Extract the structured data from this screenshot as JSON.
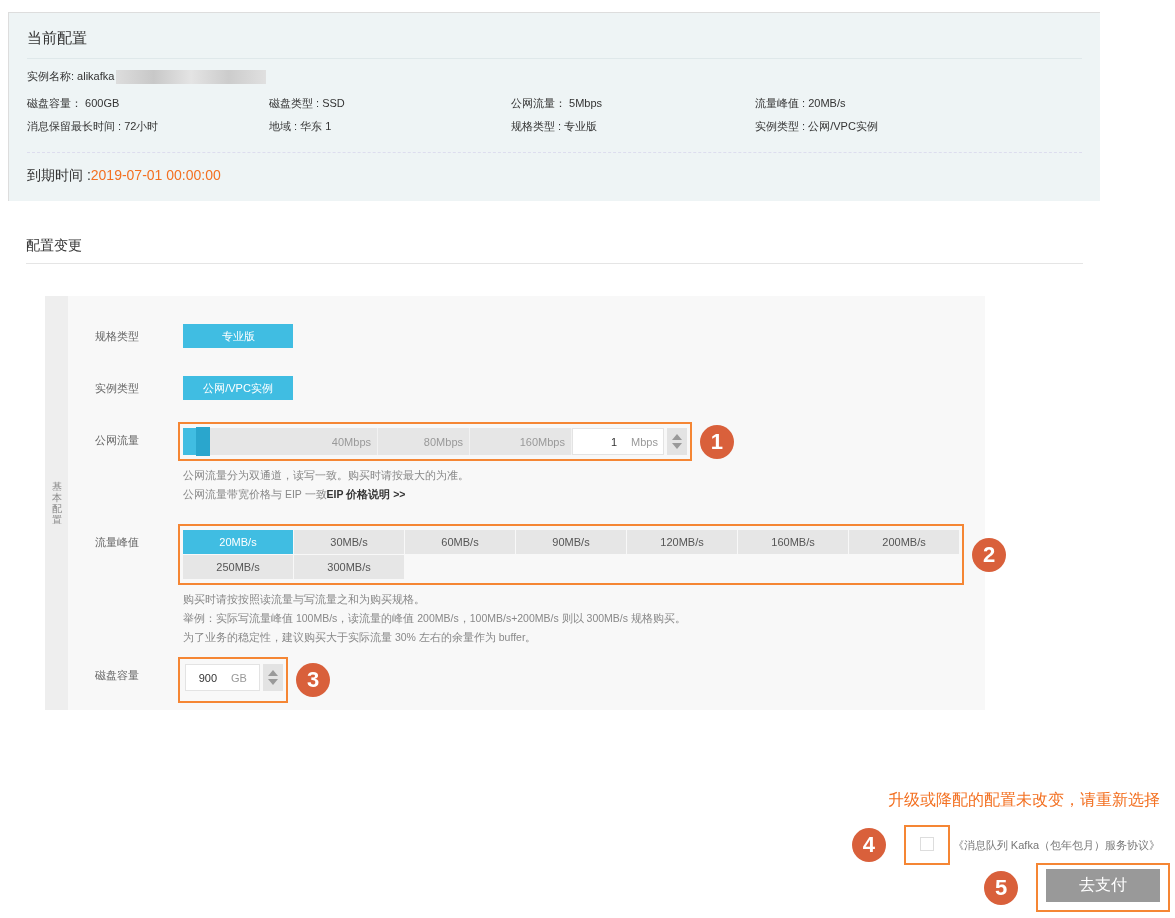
{
  "current_config": {
    "title": "当前配置",
    "instance_name": "实例名称: alikafka",
    "fields": [
      "磁盘容量： 600GB",
      "磁盘类型 : SSD",
      "公网流量： 5Mbps",
      "流量峰值 : 20MB/s",
      "消息保留最长时间 : 72小时",
      "地域 : 华东 1",
      "规格类型 : 专业版",
      "实例类型 : 公网/VPC实例"
    ],
    "expiry_label": "到期时间 :",
    "expiry_value": "2019-07-01 00:00:00"
  },
  "change_config": {
    "title": "配置变更",
    "side_label": "基本配置",
    "rows": [
      {
        "kind": "options",
        "label": "规格类型",
        "options": [
          {
            "label": "专业版",
            "selected": true
          }
        ]
      },
      {
        "kind": "options",
        "label": "实例类型",
        "options": [
          {
            "label": "公网/VPC实例",
            "selected": true
          }
        ]
      },
      {
        "kind": "slider",
        "label": "公网流量",
        "level": 0.06,
        "ticks": [
          "40Mbps",
          "80Mbps",
          "160Mbps"
        ],
        "value": "1",
        "unit": "Mbps",
        "callout": "1",
        "hints": [
          {
            "text": "公网流量分为双通道，读写一致。购买时请按最大的为准。"
          },
          {
            "text": "公网流量带宽价格与 EIP 一致",
            "link": "EIP 价格说明 >>"
          }
        ]
      },
      {
        "kind": "options",
        "label": "流量峰值",
        "callout": "2",
        "options": [
          {
            "label": "20MB/s",
            "selected": true
          },
          {
            "label": "30MB/s",
            "selected": false
          },
          {
            "label": "60MB/s",
            "selected": false
          },
          {
            "label": "90MB/s",
            "selected": false
          },
          {
            "label": "120MB/s",
            "selected": false
          },
          {
            "label": "160MB/s",
            "selected": false
          },
          {
            "label": "200MB/s",
            "selected": false
          },
          {
            "label": "250MB/s",
            "selected": false
          },
          {
            "label": "300MB/s",
            "selected": false
          }
        ],
        "hints": [
          {
            "text": "购买时请按按照读流量与写流量之和为购买规格。"
          },
          {
            "text": "举例：实际写流量峰值 100MB/s，读流量的峰值 200MB/s，100MB/s+200MB/s 则以 300MB/s 规格购买。"
          },
          {
            "text": "为了业务的稳定性，建议购买大于实际流量 30% 左右的余量作为 buffer。"
          }
        ]
      },
      {
        "kind": "number",
        "label": "磁盘容量",
        "value": "900",
        "unit": "GB",
        "callout": "3"
      }
    ]
  },
  "footer": {
    "warning": "升级或降配的配置未改变，请重新选择",
    "agreement": {
      "checked": false,
      "label": "《消息队列 Kafka（包年包月）服务协议》",
      "callout": "4"
    },
    "pay_button": {
      "label": "去支付",
      "callout": "5"
    }
  }
}
